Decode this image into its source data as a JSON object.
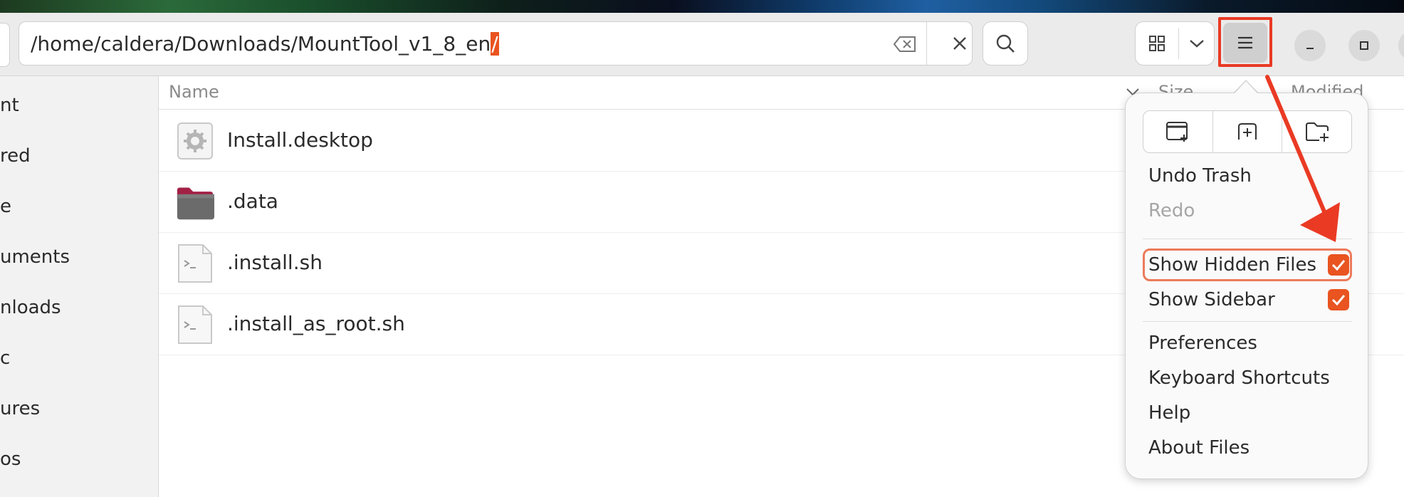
{
  "path_bar": {
    "path_text": "/home/caldera/Downloads/MountTool_v1_8_en",
    "path_slash": "/"
  },
  "sidebar": {
    "items": [
      "nt",
      "red",
      "e",
      "uments",
      "nloads",
      "c",
      "ures",
      "os"
    ]
  },
  "columns": {
    "name": "Name",
    "size": "Size",
    "modified": "Modified"
  },
  "files": [
    {
      "name": "Install.desktop",
      "icon": "settings-file-icon",
      "trail": "7"
    },
    {
      "name": ".data",
      "icon": "folder-icon",
      "trail": "7"
    },
    {
      "name": ".install.sh",
      "icon": "script-file-icon",
      "trail": "5"
    },
    {
      "name": ".install_as_root.sh",
      "icon": "script-file-icon",
      "trail": "7"
    }
  ],
  "menu": {
    "undo": "Undo Trash",
    "redo": "Redo",
    "show_hidden": "Show Hidden Files",
    "show_hidden_checked": true,
    "show_sidebar": "Show Sidebar",
    "show_sidebar_checked": true,
    "preferences": "Preferences",
    "shortcuts": "Keyboard Shortcuts",
    "help": "Help",
    "about": "About Files"
  },
  "colors": {
    "accent": "#e95420",
    "annotation": "#ea3a24"
  }
}
